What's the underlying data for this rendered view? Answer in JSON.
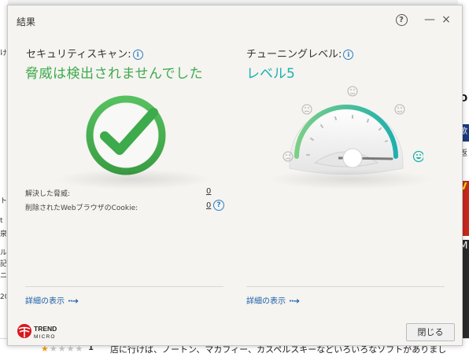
{
  "background": {
    "left_fragments": [
      "け",
      "ト",
      "t",
      "泉",
      "ル",
      "記",
      "ニ",
      "20"
    ],
    "right_fragments": [
      "O",
      "歌",
      "返",
      "V",
      "M"
    ],
    "review": {
      "stars_filled": 1,
      "stars_total": 5,
      "count": "1",
      "snippet": "店に行けば、ノートン、マカフィー、カスペルスキーなどいろいろなソフトがありまし"
    }
  },
  "dialog": {
    "title": "結果",
    "help_glyph": "?",
    "minimize_glyph": "—",
    "close_glyph": "×",
    "security": {
      "heading": "セキュリティスキャン:",
      "status": "脅威は検出されませんでした",
      "stats": [
        {
          "label": "解決した脅威:",
          "value": "0"
        },
        {
          "label": "削除されたWebブラウザのCookie:",
          "value": "0"
        }
      ],
      "details_link": "詳細の表示",
      "check_color": "#3daa4b"
    },
    "tuning": {
      "heading": "チューニングレベル:",
      "level": "レベル5",
      "level_value": 5,
      "level_max": 5,
      "details_link": "詳細の表示",
      "accent": "#1fb0ad"
    },
    "logo": {
      "line1": "TREND",
      "line2": "MICRO",
      "color": "#d71920"
    },
    "close_button": "閉じる"
  }
}
